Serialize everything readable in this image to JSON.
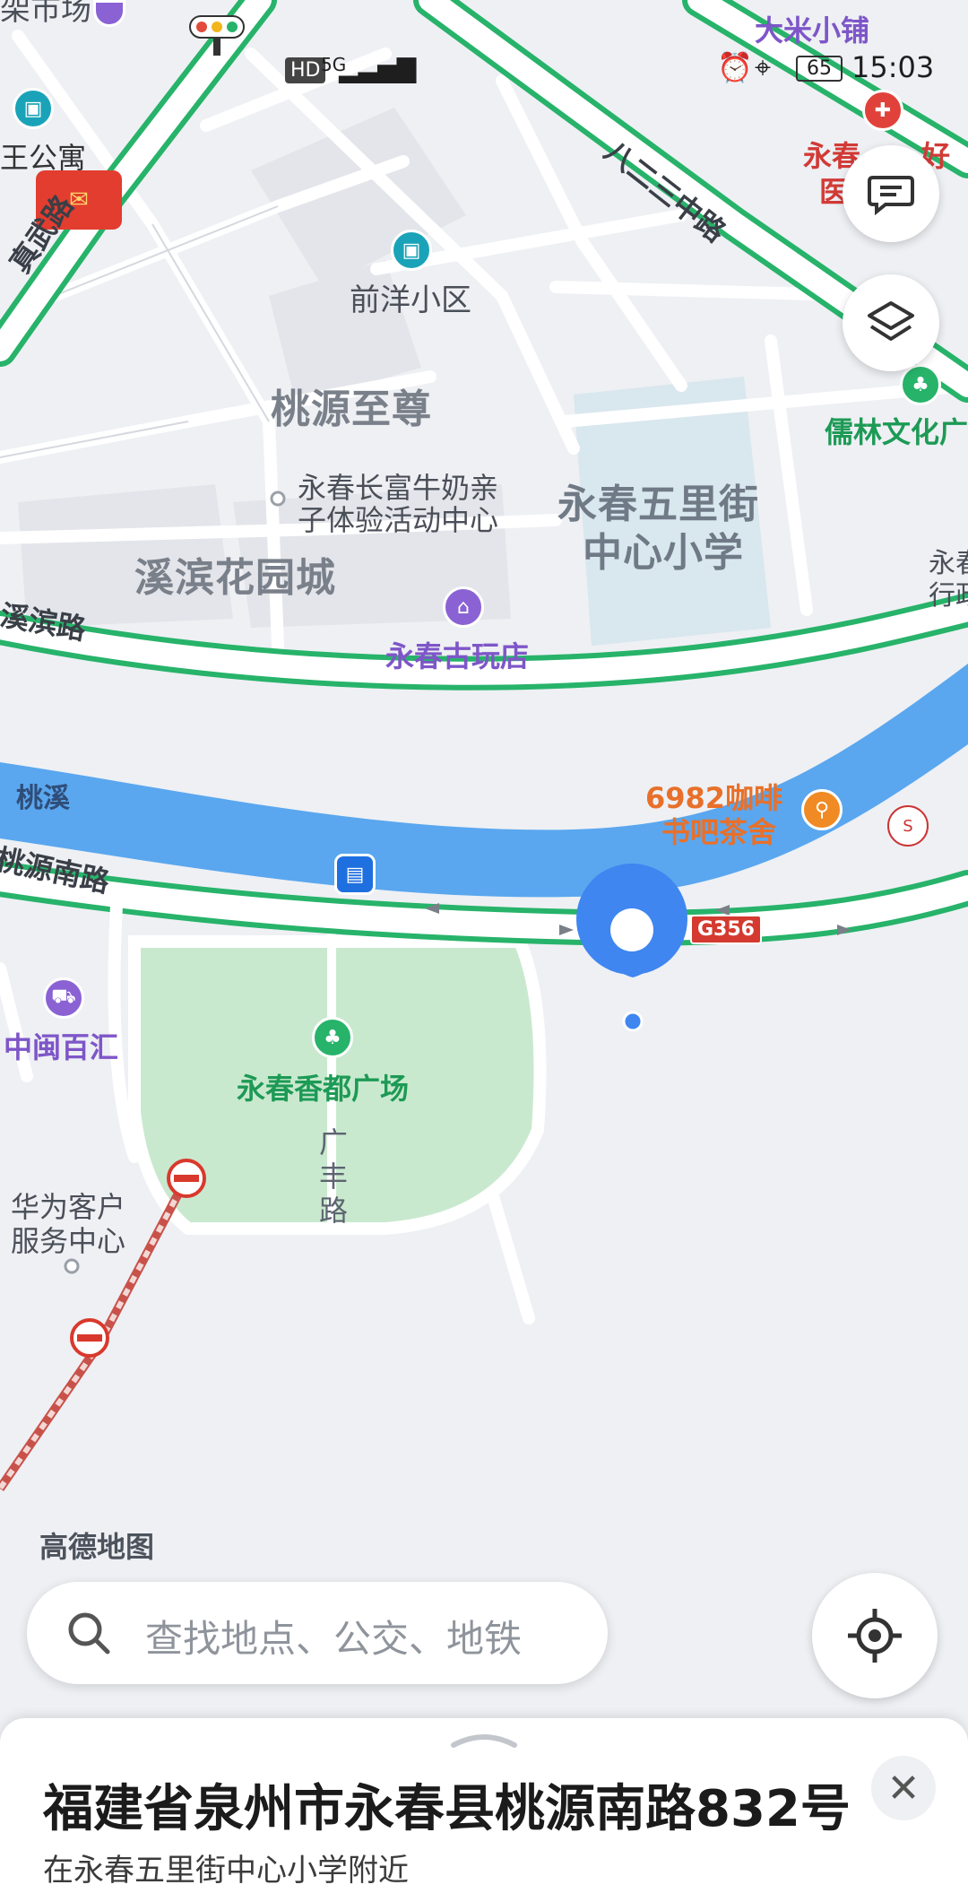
{
  "status_bar": {
    "hd": "HD",
    "network": "5G",
    "battery": "65",
    "time": "15:03"
  },
  "map": {
    "brand": "高德地图",
    "labels": {
      "top_left_cut": "架市场",
      "wang_gongyu": "王公寓",
      "zhenwu_road": "真武路",
      "qianyang": "前洋小区",
      "taoyuan_zhizun": "桃源至尊",
      "niunai_line1": "永春长富牛奶亲",
      "niunai_line2": "子体验活动中心",
      "xibin_garden": "溪滨花园城",
      "wulijie_line1": "永春五里街",
      "wulijie_line2": "中心小学",
      "xibin_road": "溪滨路",
      "antique": "永春古玩店",
      "bayisan": "八二三中路",
      "dami": "大米小铺",
      "hospital_line1": "永春",
      "hospital_line2": "医",
      "hospital_suffix": "好",
      "rulin": "儒林文化广",
      "right_edge_line1": "永春",
      "right_edge_line2": "行政",
      "taoxi": "桃溪",
      "taoyuan_south": "桃源南路",
      "coffee_line1": "6982咖啡",
      "coffee_line2": "书吧茶舍",
      "g356": "G356",
      "zhongmin": "中闽百汇",
      "xiangdu": "永春香都广场",
      "guangfeng_1": "广",
      "guangfeng_2": "丰",
      "guangfeng_3": "路",
      "huawei_line1": "华为客户",
      "huawei_line2": "服务中心"
    }
  },
  "search": {
    "placeholder": "查找地点、公交、地铁"
  },
  "sheet": {
    "address": "福建省泉州市永春县桃源南路832号",
    "nearby": "在永春五里街中心小学附近",
    "close": "✕"
  },
  "colors": {
    "road_edge": "#27b36a",
    "river": "#5aa7ef",
    "park": "#c9e9cf",
    "school": "#d9e7ee",
    "pin": "#3f86f0"
  }
}
